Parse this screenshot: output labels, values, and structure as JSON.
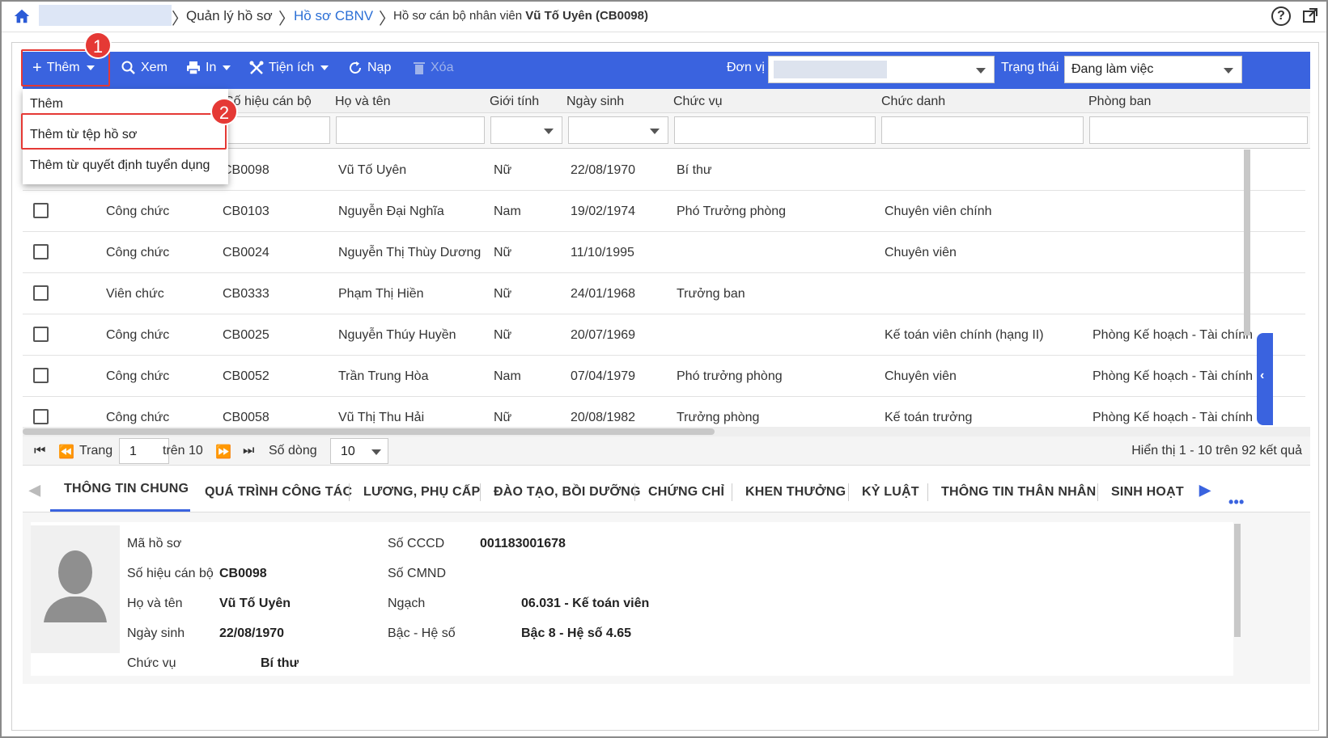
{
  "breadcrumb": {
    "item1": "Quản lý hồ sơ",
    "item2": "Hồ sơ CBNV",
    "current_prefix": "Hồ sơ cán bộ nhân viên",
    "current_name": "Vũ Tố Uyên (CB0098)"
  },
  "toolbar": {
    "add": "Thêm",
    "view": "Xem",
    "print": "In",
    "utilities": "Tiện ích",
    "reload": "Nạp",
    "delete": "Xóa",
    "unit_label": "Đơn vị",
    "status_label": "Trạng thái",
    "status_value": "Đang làm việc"
  },
  "callouts": {
    "one": "1",
    "two": "2"
  },
  "add_menu": {
    "items": [
      "Thêm",
      "Thêm từ tệp hồ sơ",
      "Thêm từ quyết định tuyển dụng"
    ]
  },
  "table": {
    "columns": [
      "Số hiệu cán bộ",
      "Họ và tên",
      "Giới tính",
      "Ngày sinh",
      "Chức vụ",
      "Chức danh",
      "Phòng ban"
    ],
    "rows": [
      {
        "type": "",
        "code": "CB0098",
        "name": "Vũ Tố Uyên",
        "gender": "Nữ",
        "dob": "22/08/1970",
        "position": "Bí thư",
        "title": "",
        "dept": ""
      },
      {
        "type": "Công chức",
        "code": "CB0103",
        "name": "Nguyễn Đại Nghĩa",
        "gender": "Nam",
        "dob": "19/02/1974",
        "position": "Phó Trưởng phòng",
        "title": "Chuyên viên chính",
        "dept": ""
      },
      {
        "type": "Công chức",
        "code": "CB0024",
        "name": "Nguyễn Thị Thùy Dương",
        "gender": "Nữ",
        "dob": "11/10/1995",
        "position": "",
        "title": "Chuyên viên",
        "dept": ""
      },
      {
        "type": "Viên chức",
        "code": "CB0333",
        "name": "Phạm Thị Hiền",
        "gender": "Nữ",
        "dob": "24/01/1968",
        "position": "Trưởng ban",
        "title": "",
        "dept": ""
      },
      {
        "type": "Công chức",
        "code": "CB0025",
        "name": "Nguyễn Thúy Huyền",
        "gender": "Nữ",
        "dob": "20/07/1969",
        "position": "",
        "title": "Kế toán viên chính (hạng II)",
        "dept": "Phòng Kế hoạch - Tài chính"
      },
      {
        "type": "Công chức",
        "code": "CB0052",
        "name": "Trần Trung Hòa",
        "gender": "Nam",
        "dob": "07/04/1979",
        "position": "Phó trưởng phòng",
        "title": "Chuyên viên",
        "dept": "Phòng Kế hoạch - Tài chính"
      },
      {
        "type": "Công chức",
        "code": "CB0058",
        "name": "Vũ Thị Thu Hải",
        "gender": "Nữ",
        "dob": "20/08/1982",
        "position": "Trưởng phòng",
        "title": "Kế toán trưởng",
        "dept": "Phòng Kế hoạch - Tài chính"
      }
    ]
  },
  "pager": {
    "page_label": "Trang",
    "page_value": "1",
    "of_label": "trên 10",
    "rows_label": "Số dòng",
    "rows_value": "10",
    "summary": "Hiển thị 1 - 10 trên 92 kết quả"
  },
  "tabs": [
    "THÔNG TIN CHUNG",
    "QUÁ TRÌNH CÔNG TÁC",
    "LƯƠNG, PHỤ CẤP",
    "ĐÀO TẠO, BỒI DƯỠNG",
    "CHỨNG CHỈ",
    "KHEN THƯỞNG",
    "KỶ LUẬT",
    "THÔNG TIN THÂN NHÂN",
    "SINH HOẠT Đ"
  ],
  "detail": {
    "record_code_label": "Mã hồ sơ",
    "record_code_value": "",
    "staff_code_label": "Số hiệu cán bộ",
    "staff_code_value": "CB0098",
    "name_label": "Họ và tên",
    "name_value": "Vũ Tố Uyên",
    "dob_label": "Ngày sinh",
    "dob_value": "22/08/1970",
    "position_label": "Chức vụ",
    "position_value": "Bí thư",
    "cccd_label": "Số CCCD",
    "cccd_value": "001183001678",
    "cmnd_label": "Số CMND",
    "cmnd_value": "",
    "grade_label": "Ngạch",
    "grade_value": "06.031 - Kế toán viên",
    "level_label": "Bậc - Hệ số",
    "level_value": "Bậc 8 - Hệ số 4.65"
  },
  "colors": {
    "accent": "#3a63df",
    "callout": "#e53935"
  }
}
